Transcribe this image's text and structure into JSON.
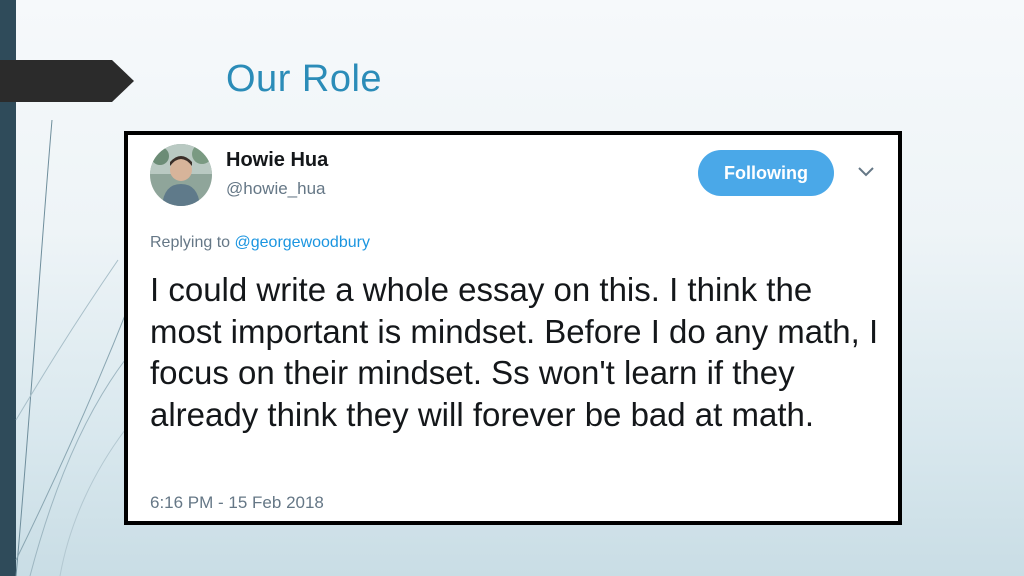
{
  "slide": {
    "title": "Our Role"
  },
  "tweet": {
    "author_name": "Howie Hua",
    "author_handle": "@howie_hua",
    "follow_button_label": "Following",
    "replying_prefix": "Replying to ",
    "replying_to": "@georgewoodbury",
    "body": "I could write a whole essay on this. I think the most important is mindset. Before I do any math, I focus on their mindset. Ss won't learn if they already think they will forever be bad at math.",
    "timestamp": "6:16 PM - 15 Feb 2018"
  },
  "colors": {
    "title": "#2b8cb8",
    "follow_button": "#4aa8e8",
    "mention": "#1b95e0",
    "left_bar": "#2f4b5a"
  },
  "icons": {
    "menu": "chevron-down-icon",
    "avatar": "avatar"
  }
}
